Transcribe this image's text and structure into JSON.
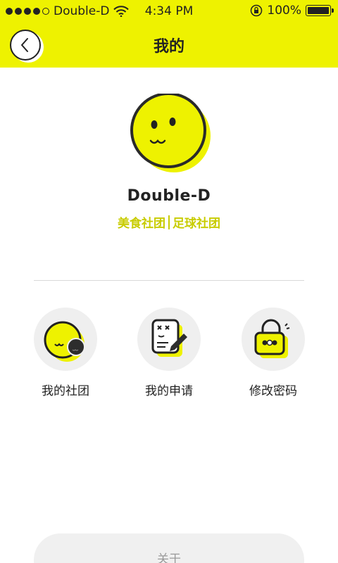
{
  "status": {
    "carrier": "Double-D",
    "time": "4:34 PM",
    "battery": "100%"
  },
  "nav": {
    "title": "我的"
  },
  "profile": {
    "name": "Double-D",
    "club_1": "美食社团",
    "club_2": "足球社团"
  },
  "actions": {
    "my_clubs": "我的社团",
    "my_applications": "我的申请",
    "change_password": "修改密码"
  },
  "footer": {
    "about": "关于"
  },
  "colors": {
    "accent": "#eef200",
    "accent_text": "#c8cc00"
  }
}
